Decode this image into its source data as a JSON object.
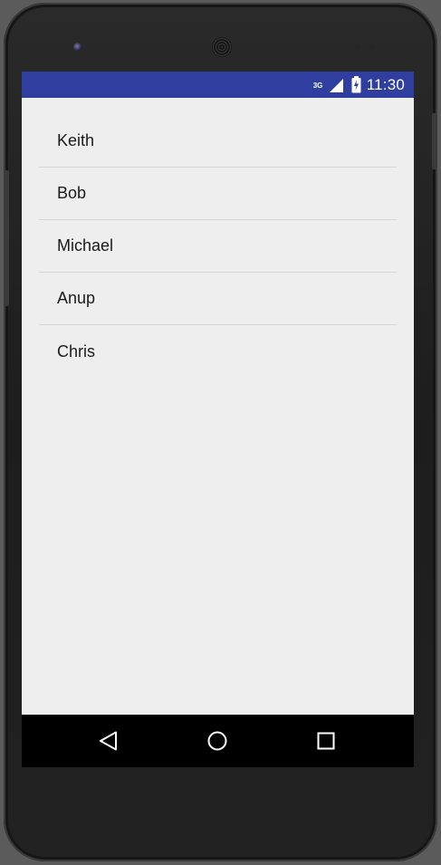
{
  "status_bar": {
    "network_type": "3G",
    "time": "11:30",
    "color": "#303f9f",
    "icons": [
      "signal-icon",
      "battery-charging-icon"
    ]
  },
  "list": {
    "items": [
      {
        "label": "Keith"
      },
      {
        "label": "Bob"
      },
      {
        "label": "Michael"
      },
      {
        "label": "Anup"
      },
      {
        "label": "Chris"
      }
    ]
  },
  "nav_bar": {
    "buttons": [
      "back-icon",
      "home-icon",
      "recents-icon"
    ]
  },
  "colors": {
    "background": "#eeeeee",
    "divider": "#d6d6d6",
    "nav_background": "#000000"
  }
}
